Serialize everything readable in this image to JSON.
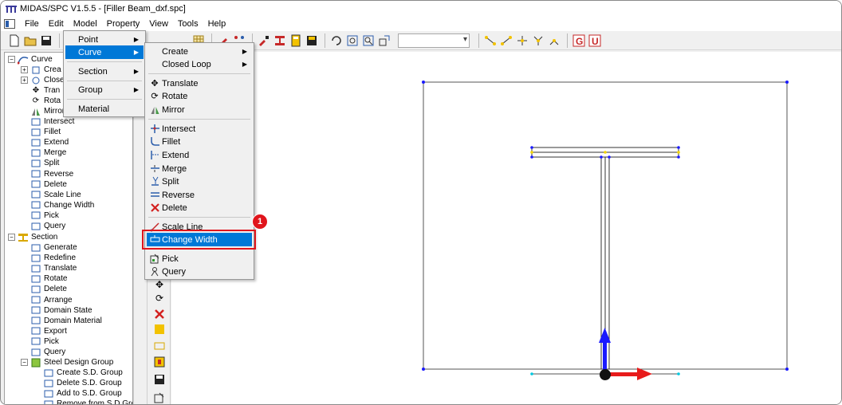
{
  "window": {
    "title": "MIDAS/SPC V1.5.5 - [Filler Beam_dxf.spc]"
  },
  "menubar": [
    "File",
    "Edit",
    "Model",
    "Property",
    "View",
    "Tools",
    "Help"
  ],
  "model_menu": {
    "items": [
      "Point",
      "Curve",
      "Section",
      "Group",
      "Material"
    ]
  },
  "curve_submenu": {
    "create": "Create",
    "closed_loop": "Closed Loop",
    "translate": "Translate",
    "rotate": "Rotate",
    "mirror": "Mirror",
    "intersect": "Intersect",
    "fillet": "Fillet",
    "extend": "Extend",
    "merge": "Merge",
    "split": "Split",
    "reverse": "Reverse",
    "delete": "Delete",
    "scale_line": "Scale Line",
    "change_width": "Change Width",
    "pick": "Pick",
    "query": "Query"
  },
  "tree": {
    "curve": "Curve",
    "curve_create": "Crea",
    "curve_closed": "Close",
    "curve_translate": "Tran",
    "curve_rotate": "Rota",
    "curve_mirror": "Mirror",
    "curve_items": [
      "Intersect",
      "Fillet",
      "Extend",
      "Merge",
      "Split",
      "Reverse",
      "Delete",
      "Scale Line",
      "Change Width",
      "Pick",
      "Query"
    ],
    "section": "Section",
    "section_items": [
      "Generate",
      "Redefine",
      "Translate",
      "Rotate",
      "Delete",
      "Arrange",
      "Domain State",
      "Domain Material",
      "Export",
      "Pick",
      "Query"
    ],
    "steel_group": "Steel Design Group",
    "steel_items": [
      "Create S.D. Group",
      "Delete S.D. Group",
      "Add to S.D. Group",
      "Remove from S.D.Gro"
    ]
  },
  "callout_number": "1",
  "colors": {
    "highlight": "#0078d7",
    "callout": "#e0151c",
    "axis_y": "#1a1aff",
    "axis_x": "#e81b1b"
  }
}
